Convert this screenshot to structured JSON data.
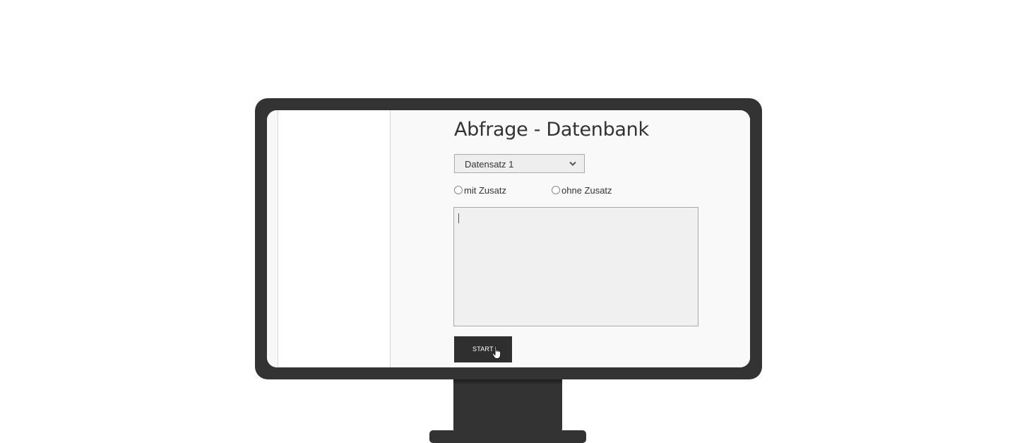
{
  "page": {
    "title": "Abfrage - Datenbank"
  },
  "dataset_select": {
    "selected": "Datensatz 1",
    "icon": "chevron-down-icon"
  },
  "radio_options": [
    {
      "label": "mit Zusatz",
      "checked": false
    },
    {
      "label": "ohne Zusatz",
      "checked": false
    }
  ],
  "query_textarea": {
    "value": ""
  },
  "start_button": {
    "label": "START"
  },
  "colors": {
    "monitor": "#333333",
    "screen_background": "#f9f9f9",
    "button": "#2f2f2f",
    "button_text": "#ffffff",
    "title_text": "#333333"
  },
  "icons": {
    "cursor": "hand-pointer-icon"
  }
}
